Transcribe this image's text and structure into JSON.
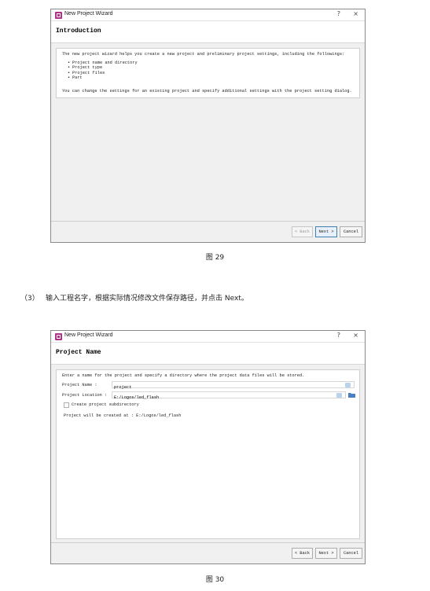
{
  "wizard1": {
    "window_title": "New Project Wizard",
    "help_btn": "?",
    "close_btn": "×",
    "header_title": "Introduction",
    "intro_text": "The new project wizard helps you create a new project and preliminary project settings, including the followings:",
    "bullets": [
      "Project name and directory",
      "Project type",
      "Project files",
      "Part"
    ],
    "note_text": "You can change the settings for an existing project and specify additional settings with the project setting dialog.",
    "buttons": {
      "back": "< Back",
      "next": "Next >",
      "cancel": "Cancel"
    }
  },
  "caption1": "图 29",
  "step": {
    "number": "（3）",
    "text": "输入工程名字，根据实际情况修改文件保存路径，并点击 Next。"
  },
  "wizard2": {
    "window_title": "New Project Wizard",
    "help_btn": "?",
    "close_btn": "×",
    "header_title": "Project Name",
    "instruction": "Enter a name for the project and specify a directory where the project data files will be stored.",
    "project_name_label": "Project Name :",
    "project_name_value": "project",
    "project_location_label": "Project Location :",
    "project_location_value": "E:/Logos/led_flash",
    "create_subdir_label": "Create project subdirectory",
    "create_subdir_checked": false,
    "created_at_text": "Project will be created at : E:/Logos/led_flash",
    "buttons": {
      "back": "< Back",
      "next": "Next >",
      "cancel": "Cancel"
    }
  },
  "caption2": "图 30",
  "colors": {
    "primary_button_border": "#3c7fb1",
    "app_icon": "#b0308a",
    "folder_icon": "#4a7fc1"
  },
  "icons": [
    "app-icon",
    "clear-icon",
    "folder-icon"
  ]
}
